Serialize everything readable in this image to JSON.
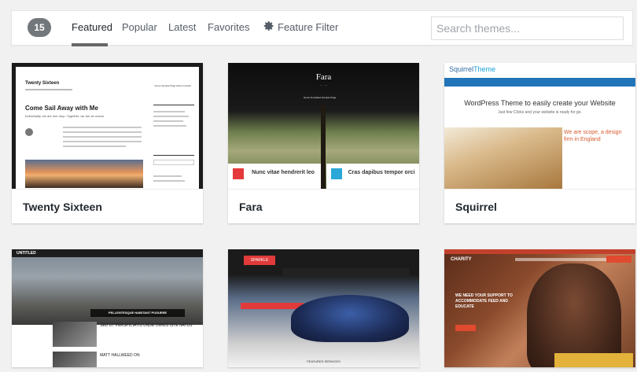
{
  "filter_bar": {
    "count": "15",
    "tabs": [
      {
        "label": "Featured",
        "active": true
      },
      {
        "label": "Popular",
        "active": false
      },
      {
        "label": "Latest",
        "active": false
      },
      {
        "label": "Favorites",
        "active": false
      }
    ],
    "feature_filter_label": "Feature Filter",
    "search_placeholder": "Search themes..."
  },
  "themes": [
    {
      "name": "Twenty Sixteen",
      "preview": {
        "site_title": "Twenty Sixteen",
        "nav": "Home   Sample Page   About   Contact",
        "headline": "Come Sail Away with Me",
        "subline": "Individually, we are one drop. Together, we are an ocean."
      }
    },
    {
      "name": "Fara",
      "preview": {
        "site_title": "Fara",
        "nav": "Home   Templates   Sample Page",
        "panel_left": "Nunc vitae hendrerit leo",
        "panel_right": "Cras dapibus tempor orci"
      }
    },
    {
      "name": "Squirrel",
      "preview": {
        "logo_a": "Squirrel",
        "logo_b": "Theme",
        "headline": "WordPress Theme to easily create your Website",
        "subline": "Just few Clicks and your website is ready for go.",
        "side_text": "We are scope, a design firm in England"
      }
    },
    {
      "name": "",
      "preview": {
        "logo": "UNTITLED",
        "banner": "PELLENTESQUE HABITANT POSUERE",
        "item1": "SED UT PERSPICIATIS UNDE OMNIS ISTE NATUS",
        "item2": "MATT HALLWEED ON"
      }
    },
    {
      "name": "",
      "preview": {
        "logo": "SPARKLE",
        "featured": "FEATURED SERVICES"
      }
    },
    {
      "name": "",
      "preview": {
        "logo": "CHARITY",
        "headline": "WE NEED YOUR SUPPORT TO ACCOMMODATE FEED AND EDUCATE"
      }
    }
  ],
  "colors": {
    "accent_blue": "#2274b8",
    "count_badge": "#72777c",
    "charity_red": "#e04a2f",
    "sparkle_red": "#e03a3a"
  }
}
